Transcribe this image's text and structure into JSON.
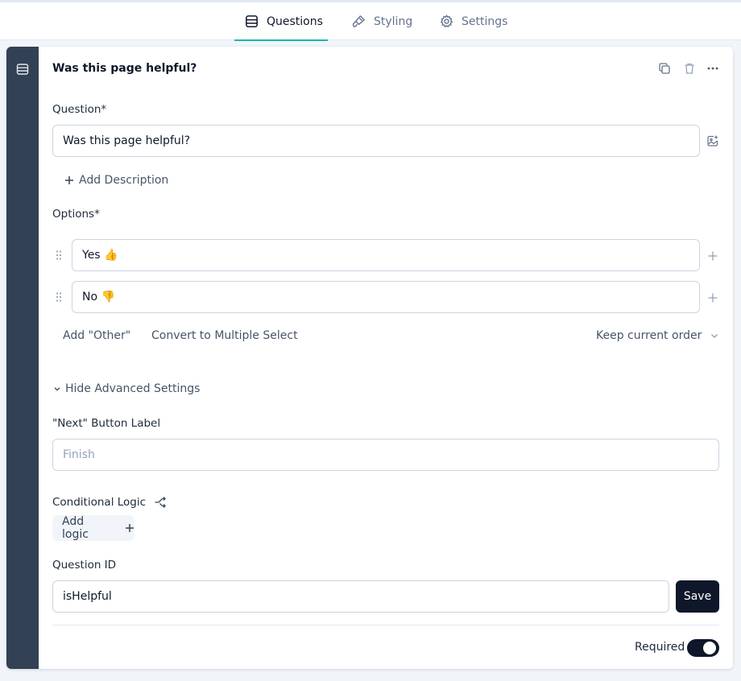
{
  "tabs": [
    {
      "label": "Questions",
      "icon": "list-icon",
      "active": true
    },
    {
      "label": "Styling",
      "icon": "paintbrush-icon",
      "active": false
    },
    {
      "label": "Settings",
      "icon": "gear-icon",
      "active": false
    }
  ],
  "card": {
    "title": "Was this page helpful?",
    "question_label": "Question*",
    "question_value": "Was this page helpful?",
    "add_description": "Add Description",
    "options_label": "Options*",
    "options": [
      {
        "value": "Yes 👍"
      },
      {
        "value": "No 👎"
      }
    ],
    "add_other": "Add \"Other\"",
    "convert": "Convert to Multiple Select",
    "order": "Keep current order",
    "advanced_toggle": "Hide Advanced Settings",
    "next_label": "\"Next\" Button Label",
    "next_placeholder": "Finish",
    "conditional_logic": "Conditional Logic",
    "add_logic": "Add logic",
    "question_id_label": "Question ID",
    "question_id_value": "isHelpful",
    "save": "Save",
    "required": "Required",
    "required_on": true
  },
  "colors": {
    "accent": "#14b8a6",
    "rail": "#334155",
    "primary_button": "#0f172a"
  }
}
